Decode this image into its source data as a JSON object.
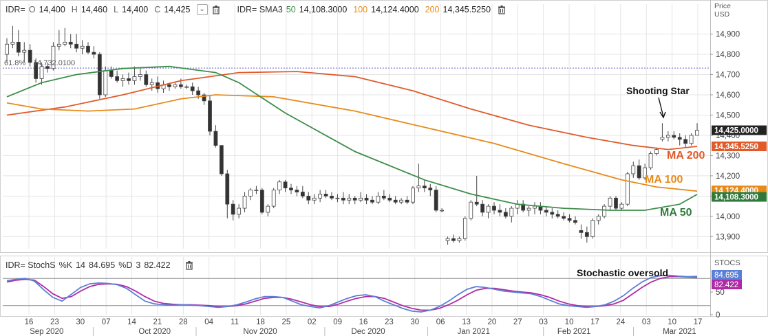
{
  "header": {
    "symbol": "IDR=",
    "open_label": "O",
    "open_value": "14,400",
    "high_label": "H",
    "high_value": "14,460",
    "low_label": "L",
    "low_value": "14,400",
    "close_label": "C",
    "close_value": "14,425",
    "dropdown_glyph": "⌄",
    "sma_label": "IDR= SMA3",
    "sma50_label": "50",
    "sma50_value": "14,108.3000",
    "sma100_label": "100",
    "sma100_value": "14,124.4000",
    "sma200_label": "200",
    "sma200_value": "14,345.5250"
  },
  "stoch_header": {
    "label": "IDR= StochS",
    "k_label": "%K",
    "k_period": "14",
    "k_value": "84.695",
    "d_label": "%D",
    "d_period": "3",
    "d_value": "82.422"
  },
  "colors": {
    "up": "#ffffff",
    "down": "#333333",
    "ma50": "#3c8d4a",
    "ma100": "#e88a1a",
    "ma200": "#e05a2a",
    "stoch_k": "#5b7fd6",
    "stoch_d": "#b02aa6",
    "grid": "#e4e4e4",
    "fib_line": "#8a7fd6"
  },
  "chart_data": [
    {
      "type": "candlestick",
      "title": "",
      "ylabel": "Price USD",
      "ylim": [
        13840,
        14980
      ],
      "y_ticks": [
        "13,900",
        "14,000",
        "14,100",
        "14,200",
        "14,300",
        "14,400",
        "14,500",
        "14,600",
        "14,700",
        "14,800",
        "14,900"
      ],
      "x_ticks": [
        "16",
        "23",
        "30",
        "07",
        "14",
        "21",
        "28",
        "04",
        "11",
        "18",
        "25",
        "02",
        "09",
        "16",
        "23",
        "30",
        "06",
        "13",
        "20",
        "27",
        "03",
        "10",
        "17",
        "24",
        "03",
        "10",
        "17"
      ],
      "month_labels": [
        "Sep 2020",
        "Oct 2020",
        "Nov 2020",
        "Dec 2020",
        "Jan 2021",
        "Feb 2021",
        "Mar 2021"
      ],
      "fib_level_label": "61.8%",
      "fib_level_value_label": "14,732.0100",
      "fib_level": 14732.01,
      "last_price_labels": {
        "close": "14,425.0000",
        "ma200": "14,345.5250",
        "ma100": "14,124.4000",
        "ma50": "14,108.3000"
      },
      "annotations": {
        "shooting_star": "Shooting Star",
        "ma200": "MA 200",
        "ma100": "MA 100",
        "ma50": "MA 50"
      },
      "candles": [
        [
          14800,
          14880,
          14760,
          14850
        ],
        [
          14850,
          14940,
          14830,
          14860
        ],
        [
          14860,
          14920,
          14790,
          14810
        ],
        [
          14810,
          14860,
          14760,
          14820
        ],
        [
          14820,
          14850,
          14740,
          14760
        ],
        [
          14760,
          14780,
          14660,
          14680
        ],
        [
          14680,
          14760,
          14650,
          14740
        ],
        [
          14740,
          14760,
          14710,
          14730
        ],
        [
          14730,
          14860,
          14720,
          14840
        ],
        [
          14840,
          14920,
          14820,
          14850
        ],
        [
          14850,
          14930,
          14840,
          14860
        ],
        [
          14860,
          14900,
          14830,
          14850
        ],
        [
          14850,
          14900,
          14810,
          14830
        ],
        [
          14830,
          14870,
          14800,
          14840
        ],
        [
          14840,
          14860,
          14800,
          14810
        ],
        [
          14810,
          14840,
          14780,
          14800
        ],
        [
          14800,
          14810,
          14580,
          14600
        ],
        [
          14600,
          14740,
          14590,
          14720
        ],
        [
          14720,
          14740,
          14680,
          14690
        ],
        [
          14690,
          14720,
          14660,
          14670
        ],
        [
          14670,
          14700,
          14640,
          14680
        ],
        [
          14680,
          14710,
          14650,
          14670
        ],
        [
          14670,
          14740,
          14650,
          14690
        ],
        [
          14690,
          14730,
          14670,
          14700
        ],
        [
          14700,
          14720,
          14640,
          14650
        ],
        [
          14650,
          14680,
          14620,
          14660
        ],
        [
          14660,
          14690,
          14610,
          14630
        ],
        [
          14630,
          14670,
          14610,
          14650
        ],
        [
          14650,
          14660,
          14620,
          14640
        ],
        [
          14640,
          14660,
          14630,
          14650
        ],
        [
          14650,
          14680,
          14630,
          14640
        ],
        [
          14640,
          14650,
          14630,
          14640
        ],
        [
          14640,
          14660,
          14600,
          14620
        ],
        [
          14620,
          14640,
          14580,
          14600
        ],
        [
          14600,
          14610,
          14550,
          14570
        ],
        [
          14570,
          14600,
          14400,
          14420
        ],
        [
          14420,
          14450,
          14340,
          14350
        ],
        [
          14350,
          14290,
          14200,
          14210
        ],
        [
          14210,
          14230,
          13990,
          14060
        ],
        [
          14060,
          14080,
          13980,
          14010
        ],
        [
          14010,
          14060,
          13990,
          14040
        ],
        [
          14040,
          14120,
          14020,
          14100
        ],
        [
          14100,
          14140,
          14080,
          14130
        ],
        [
          14130,
          14150,
          14110,
          14130
        ],
        [
          14130,
          14140,
          14010,
          14020
        ],
        [
          14020,
          14060,
          14000,
          14050
        ],
        [
          14050,
          14140,
          14040,
          14130
        ],
        [
          14130,
          14180,
          14110,
          14170
        ],
        [
          14170,
          14180,
          14120,
          14140
        ],
        [
          14140,
          14160,
          14110,
          14130
        ],
        [
          14130,
          14150,
          14100,
          14120
        ],
        [
          14120,
          14150,
          14090,
          14100
        ],
        [
          14100,
          14120,
          14060,
          14080
        ],
        [
          14080,
          14110,
          14060,
          14090
        ],
        [
          14090,
          14130,
          14070,
          14110
        ],
        [
          14110,
          14130,
          14090,
          14100
        ],
        [
          14100,
          14120,
          14080,
          14090
        ],
        [
          14090,
          14110,
          14070,
          14090
        ],
        [
          14090,
          14120,
          14060,
          14080
        ],
        [
          14080,
          14110,
          14060,
          14090
        ],
        [
          14090,
          14100,
          14060,
          14080
        ],
        [
          14080,
          14120,
          14070,
          14090
        ],
        [
          14090,
          14110,
          14060,
          14080
        ],
        [
          14080,
          14100,
          14060,
          14070
        ],
        [
          14070,
          14120,
          14060,
          14100
        ],
        [
          14100,
          14130,
          14080,
          14090
        ],
        [
          14090,
          14110,
          14070,
          14080
        ],
        [
          14080,
          14100,
          14060,
          14070
        ],
        [
          14070,
          14090,
          14060,
          14080
        ],
        [
          14080,
          14100,
          14060,
          14070
        ],
        [
          14070,
          14150,
          14060,
          14140
        ],
        [
          14140,
          14260,
          14120,
          14150
        ],
        [
          14150,
          14180,
          14120,
          14140
        ],
        [
          14140,
          14160,
          14100,
          14130
        ],
        [
          14130,
          14150,
          14020,
          14030
        ],
        [
          14030,
          14040,
          14020,
          14030
        ],
        [
          13880,
          13900,
          13860,
          13890
        ],
        [
          13890,
          13910,
          13870,
          13880
        ],
        [
          13880,
          13900,
          13870,
          13890
        ],
        [
          13890,
          14000,
          13880,
          13990
        ],
        [
          13990,
          14080,
          13980,
          14070
        ],
        [
          14070,
          14200,
          14050,
          14060
        ],
        [
          14060,
          14080,
          14000,
          14020
        ],
        [
          14020,
          14060,
          13990,
          14050
        ],
        [
          14050,
          14070,
          14010,
          14030
        ],
        [
          14030,
          14060,
          14000,
          14020
        ],
        [
          14020,
          14040,
          13990,
          14000
        ],
        [
          14000,
          14050,
          13970,
          14040
        ],
        [
          14040,
          14080,
          14010,
          14060
        ],
        [
          14060,
          14080,
          14020,
          14030
        ],
        [
          14030,
          14050,
          14000,
          14040
        ],
        [
          14040,
          14070,
          14010,
          14050
        ],
        [
          14050,
          14070,
          14010,
          14030
        ],
        [
          14030,
          14050,
          14000,
          14020
        ],
        [
          14020,
          14040,
          13990,
          14010
        ],
        [
          14010,
          14030,
          13990,
          14000
        ],
        [
          14000,
          14020,
          13980,
          13990
        ],
        [
          13990,
          14010,
          13970,
          13980
        ],
        [
          13980,
          14000,
          13960,
          13970
        ],
        [
          13930,
          13960,
          13890,
          13920
        ],
        [
          13920,
          13950,
          13870,
          13900
        ],
        [
          13900,
          13990,
          13890,
          13980
        ],
        [
          13980,
          14010,
          13960,
          14000
        ],
        [
          14000,
          14060,
          13990,
          14050
        ],
        [
          14050,
          14100,
          14030,
          14090
        ],
        [
          14090,
          14100,
          14030,
          14040
        ],
        [
          14040,
          14070,
          14030,
          14060
        ],
        [
          14060,
          14220,
          14050,
          14210
        ],
        [
          14210,
          14270,
          14190,
          14250
        ],
        [
          14250,
          14280,
          14180,
          14190
        ],
        [
          14190,
          14260,
          14180,
          14240
        ],
        [
          14240,
          14320,
          14230,
          14310
        ],
        [
          14310,
          14340,
          14300,
          14330
        ],
        [
          14380,
          14460,
          14370,
          14390
        ],
        [
          14390,
          14420,
          14370,
          14400
        ],
        [
          14400,
          14420,
          14380,
          14390
        ],
        [
          14390,
          14410,
          14350,
          14380
        ],
        [
          14380,
          14400,
          14340,
          14360
        ],
        [
          14360,
          14410,
          14350,
          14400
        ],
        [
          14400,
          14460,
          14400,
          14425
        ]
      ],
      "ma50": [
        [
          0,
          14590
        ],
        [
          6,
          14660
        ],
        [
          12,
          14700
        ],
        [
          20,
          14730
        ],
        [
          28,
          14740
        ],
        [
          36,
          14710
        ],
        [
          40,
          14660
        ],
        [
          48,
          14510
        ],
        [
          60,
          14320
        ],
        [
          72,
          14180
        ],
        [
          80,
          14110
        ],
        [
          88,
          14060
        ],
        [
          96,
          14040
        ],
        [
          104,
          14030
        ],
        [
          110,
          14030
        ],
        [
          116,
          14060
        ],
        [
          119,
          14108.3
        ]
      ],
      "ma100": [
        [
          0,
          14560
        ],
        [
          6,
          14530
        ],
        [
          14,
          14520
        ],
        [
          22,
          14530
        ],
        [
          30,
          14580
        ],
        [
          36,
          14600
        ],
        [
          46,
          14590
        ],
        [
          60,
          14520
        ],
        [
          72,
          14440
        ],
        [
          84,
          14360
        ],
        [
          96,
          14260
        ],
        [
          106,
          14180
        ],
        [
          112,
          14145
        ],
        [
          119,
          14124.4
        ]
      ],
      "ma200": [
        [
          0,
          14500
        ],
        [
          10,
          14540
        ],
        [
          20,
          14600
        ],
        [
          30,
          14670
        ],
        [
          40,
          14710
        ],
        [
          50,
          14715
        ],
        [
          60,
          14690
        ],
        [
          70,
          14620
        ],
        [
          80,
          14530
        ],
        [
          90,
          14450
        ],
        [
          100,
          14390
        ],
        [
          108,
          14350
        ],
        [
          114,
          14330
        ],
        [
          119,
          14345.525
        ]
      ]
    },
    {
      "type": "line",
      "title": "",
      "ylabel": "STOCS",
      "ylim": [
        0,
        100
      ],
      "y_ticks": [
        "0",
        "50"
      ],
      "levels": [
        80,
        20
      ],
      "series": [
        {
          "name": "%K",
          "values": [
            75,
            78,
            80,
            74,
            55,
            38,
            30,
            45,
            60,
            68,
            70,
            69,
            66,
            58,
            44,
            30,
            24,
            22,
            21,
            22,
            21,
            20,
            18,
            16,
            18,
            22,
            28,
            35,
            40,
            40,
            38,
            30,
            22,
            18,
            15,
            20,
            28,
            36,
            42,
            44,
            40,
            30,
            22,
            14,
            8,
            6,
            10,
            18,
            30,
            44,
            56,
            62,
            60,
            56,
            52,
            50,
            48,
            46,
            40,
            32,
            24,
            20,
            18,
            16,
            18,
            22,
            30,
            42,
            58,
            72,
            82,
            86,
            87,
            85,
            84,
            84.695
          ]
        },
        {
          "name": "%D",
          "values": [
            72,
            76,
            78,
            76,
            62,
            46,
            36,
            40,
            52,
            62,
            67,
            68,
            67,
            62,
            52,
            40,
            30,
            25,
            23,
            22,
            22,
            21,
            20,
            18,
            18,
            20,
            24,
            30,
            36,
            38,
            38,
            34,
            28,
            22,
            18,
            18,
            23,
            30,
            36,
            40,
            40,
            36,
            28,
            20,
            14,
            10,
            10,
            14,
            22,
            32,
            44,
            54,
            58,
            58,
            55,
            52,
            50,
            48,
            44,
            38,
            30,
            24,
            20,
            18,
            18,
            20,
            24,
            32,
            46,
            60,
            72,
            80,
            84,
            84,
            83,
            82.422
          ]
        }
      ],
      "annotation": "Stochastic oversold",
      "last_value_labels": {
        "k": "84.695",
        "d": "82.422"
      }
    }
  ]
}
